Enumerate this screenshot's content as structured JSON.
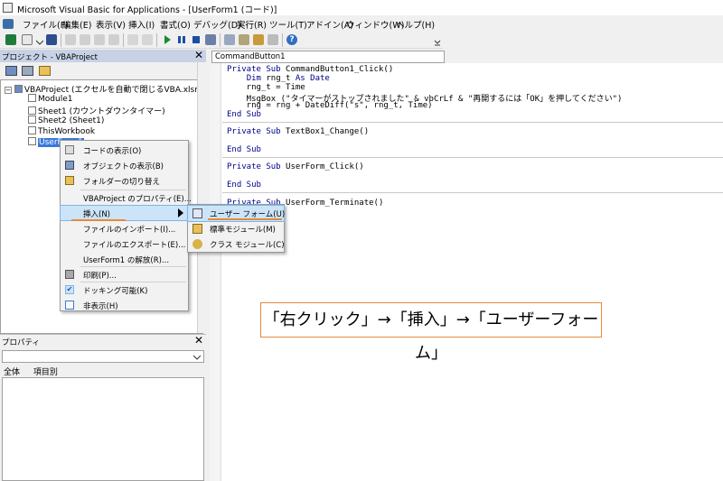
{
  "window": {
    "title": "Microsoft Visual Basic for Applications - [UserForm1 (コード)]"
  },
  "menubar": [
    "ファイル(F)",
    "編集(E)",
    "表示(V)",
    "挿入(I)",
    "書式(O)",
    "デバッグ(D)",
    "実行(R)",
    "ツール(T)",
    "アドイン(A)",
    "ウィンドウ(W)",
    "ヘルプ(H)"
  ],
  "toolbar": {
    "icons": [
      "excel-icon",
      "insert-userform-icon",
      "save-icon",
      "cut-icon",
      "copy-icon",
      "paste-icon",
      "find-icon",
      "undo-icon",
      "redo-icon",
      "run-icon",
      "break-icon",
      "reset-icon",
      "design-mode-icon",
      "project-explorer-icon",
      "properties-icon",
      "object-browser-icon",
      "toolbox-icon",
      "help-icon"
    ]
  },
  "project_panel": {
    "title": "プロジェクト - VBAProject",
    "tree": {
      "root": "VBAProject (エクセルを自動で閉じるVBA.xlsm)",
      "items": [
        "Module1",
        "Sheet1 (カウントダウンタイマー)",
        "Sheet2 (Sheet1)",
        "ThisWorkbook",
        "UserForm1"
      ]
    }
  },
  "properties_panel": {
    "title": "プロパティ",
    "tabs": [
      "全体",
      "項目別"
    ]
  },
  "code_window": {
    "object_combo": "CommandButton1",
    "lines": {
      "l1": "Private Sub CommandButton1_Click()",
      "l2": "    Dim rng_t As Date",
      "l3": "    rng_t = Time",
      "l4": "    MsgBox (\"タイマーがストップされました\" & vbCrLf & \"再開するには「OK」を押してください\")",
      "l5": "    rng = rng + DateDiff(\"s\", rng_t, Time)",
      "l6": "End Sub",
      "l7": "Private Sub TextBox1_Change()",
      "l8": "End Sub",
      "l9": "Private Sub UserForm_Click()",
      "l10": "End Sub",
      "l11": "Private Sub UserForm_Terminate()"
    }
  },
  "context_menu": {
    "items": {
      "view_code": "コードの表示(O)",
      "view_object": "オブジェクトの表示(B)",
      "toggle_folders": "フォルダーの切り替え",
      "project_properties": "VBAProject のプロパティ(E)...",
      "insert": "挿入(N)",
      "import_file": "ファイルのインポート(I)...",
      "export_file": "ファイルのエクスポート(E)...",
      "remove": "UserForm1 の解放(R)...",
      "print": "印刷(P)...",
      "dockable": "ドッキング可能(K)",
      "hide": "非表示(H)"
    }
  },
  "submenu": {
    "userform": "ユーザー フォーム(U)",
    "module": "標準モジュール(M)",
    "class_module": "クラス モジュール(C)"
  },
  "annotation": "「右クリック」→「挿入」→「ユーザーフォーム」",
  "colors": {
    "accent": "#e58a3a",
    "highlight": "#cce4f7",
    "keyword": "#00008b"
  }
}
